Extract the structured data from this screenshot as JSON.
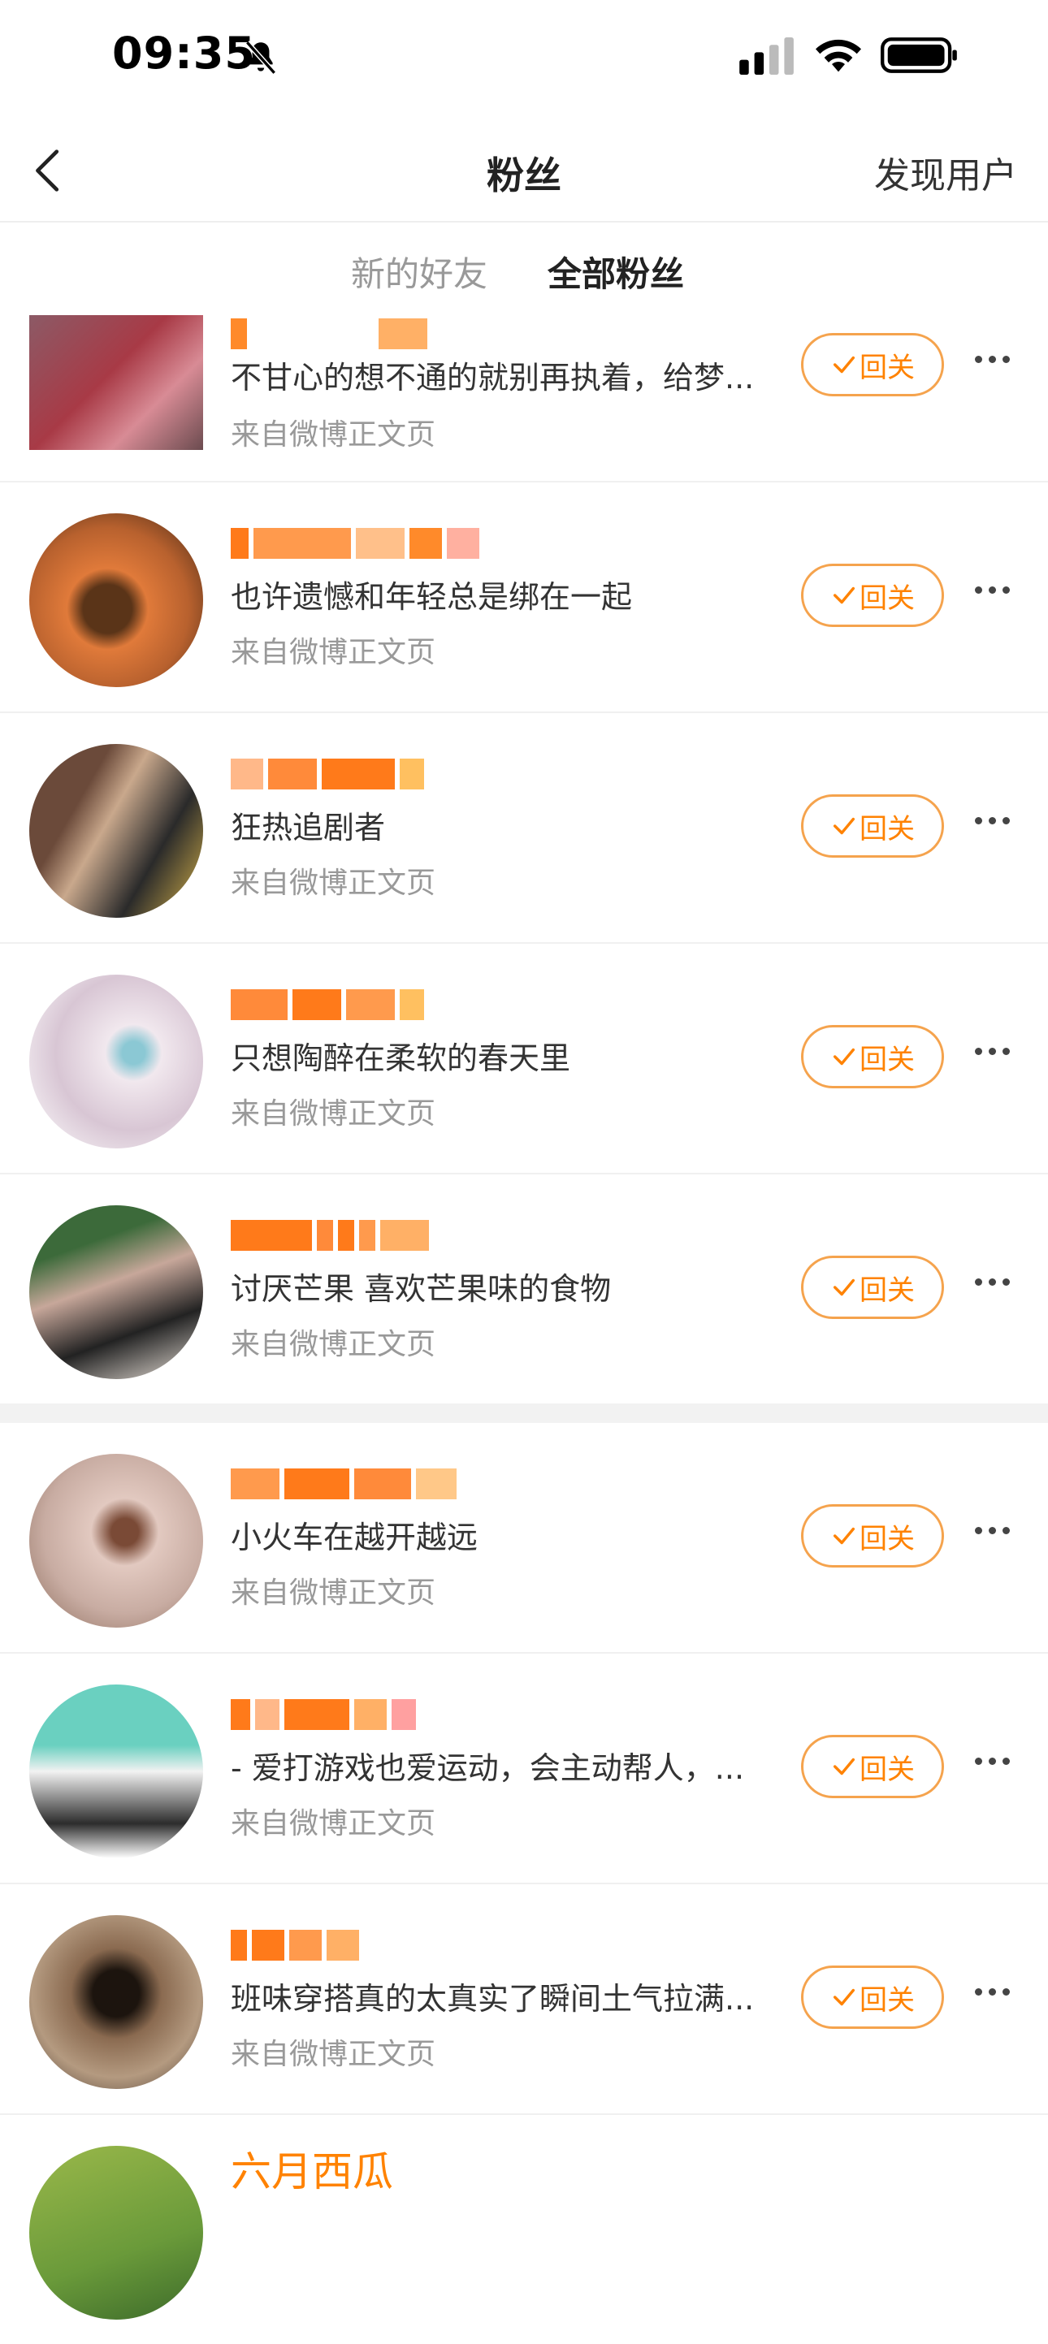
{
  "status_bar": {
    "time": "09:35"
  },
  "nav": {
    "title": "粉丝",
    "right_action": "发现用户"
  },
  "tabs": [
    {
      "label": "新的好友",
      "active": false
    },
    {
      "label": "全部粉丝",
      "active": true
    }
  ],
  "colors": {
    "accent": "#ff8200",
    "secondary_text": "#999999",
    "divider": "#f0f0f0"
  },
  "follow_button_label": "回关",
  "fans": [
    {
      "bio": "不甘心的想不通的就别再执着，给梦...",
      "source": "来自微博正文页"
    },
    {
      "bio": "也许遗憾和年轻总是绑在一起",
      "source": "来自微博正文页"
    },
    {
      "bio": "狂热追剧者",
      "source": "来自微博正文页"
    },
    {
      "bio": "只想陶醉在柔软的春天里",
      "source": "来自微博正文页"
    },
    {
      "bio": "讨厌芒果 喜欢芒果味的食物",
      "source": "来自微博正文页"
    },
    {
      "bio": "小火车在越开越远",
      "source": "来自微博正文页"
    },
    {
      "bio": "- 爱打游戏也爱运动，会主动帮人，...",
      "source": "来自微博正文页"
    },
    {
      "bio": "班味穿搭真的太真实了瞬间土气拉满...",
      "source": "来自微博正文页"
    },
    {
      "name": "六月西瓜"
    }
  ]
}
